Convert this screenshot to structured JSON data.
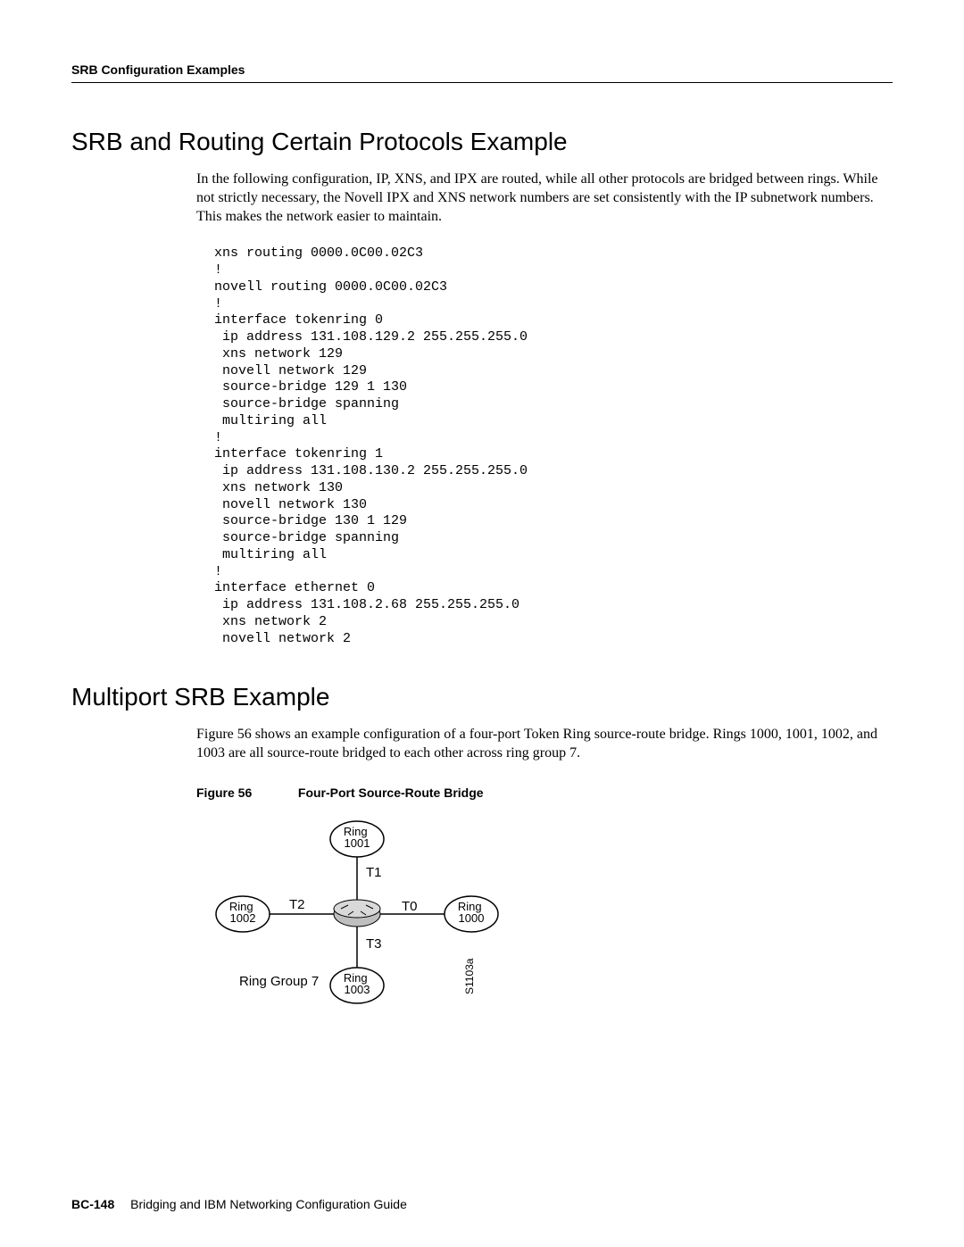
{
  "header": {
    "running": "SRB Configuration Examples"
  },
  "section1": {
    "title": "SRB and Routing Certain Protocols Example",
    "para": "In the following configuration, IP, XNS, and IPX are routed, while all other protocols are bridged between rings. While not strictly necessary, the Novell IPX and XNS network numbers are set consistently with the IP subnetwork numbers. This makes the network easier to maintain.",
    "config": "xns routing 0000.0C00.02C3\n!\nnovell routing 0000.0C00.02C3\n!\ninterface tokenring 0\n ip address 131.108.129.2 255.255.255.0\n xns network 129\n novell network 129\n source-bridge 129 1 130\n source-bridge spanning\n multiring all\n!\ninterface tokenring 1\n ip address 131.108.130.2 255.255.255.0\n xns network 130\n novell network 130\n source-bridge 130 1 129\n source-bridge spanning\n multiring all\n!\ninterface ethernet 0\n ip address 131.108.2.68 255.255.255.0\n xns network 2\n novell network 2"
  },
  "section2": {
    "title": "Multiport SRB Example",
    "para": "Figure 56 shows an example configuration of a four-port Token Ring source-route bridge. Rings 1000, 1001, 1002, and 1003 are all source-route bridged to each other across ring group 7.",
    "figure": {
      "label": "Figure 56",
      "title": "Four-Port Source-Route Bridge",
      "ring_top": "Ring\n1001",
      "ring_right": "Ring\n1000",
      "ring_bottom": "Ring\n1003",
      "ring_left": "Ring\n1002",
      "port_top": "T1",
      "port_right": "T0",
      "port_bottom": "T3",
      "port_left": "T2",
      "group_label": "Ring Group 7",
      "art_id": "S1103a"
    }
  },
  "footer": {
    "page": "BC-148",
    "book": "Bridging and IBM Networking Configuration Guide"
  }
}
